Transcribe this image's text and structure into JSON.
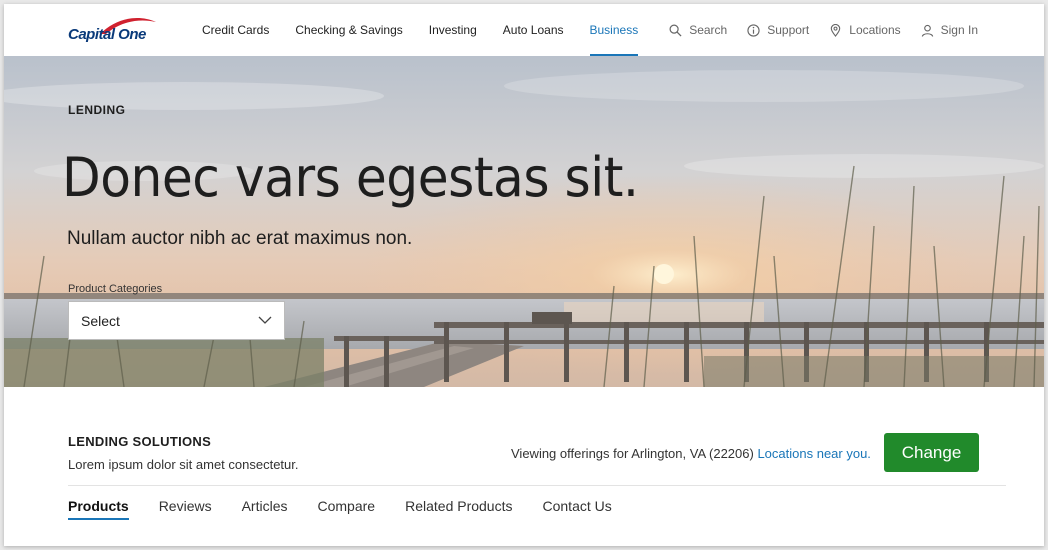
{
  "brand": {
    "logo_text": "Capital One",
    "colors": {
      "navy": "#0a3a7a",
      "swoosh": "#d0212f",
      "link": "#1a76b8",
      "cta": "#218a2b"
    }
  },
  "nav": {
    "links": [
      {
        "label": "Credit Cards",
        "active": false
      },
      {
        "label": "Checking & Savings",
        "active": false
      },
      {
        "label": "Investing",
        "active": false
      },
      {
        "label": "Auto Loans",
        "active": false
      },
      {
        "label": "Business",
        "active": true
      }
    ],
    "utilities": [
      {
        "label": "Search",
        "icon": "search-icon"
      },
      {
        "label": "Support",
        "icon": "info-circle-icon"
      },
      {
        "label": "Locations",
        "icon": "map-pin-icon"
      },
      {
        "label": "Sign In",
        "icon": "user-icon"
      }
    ]
  },
  "hero": {
    "eyebrow": "LENDING",
    "title": "Donec vars egestas sit.",
    "subtitle": "Nullam auctor nibh ac erat maximus non.",
    "select": {
      "label": "Product Categories",
      "value": "Select",
      "icon": "chevron-down-icon"
    }
  },
  "solutions": {
    "title": "LENDING SOLUTIONS",
    "description": "Lorem ipsum dolor sit amet consectetur.",
    "viewing_text": "Viewing offerings for Arlington, VA (22206)",
    "viewing_link": "Locations near you.",
    "change_button": "Change",
    "tabs": [
      {
        "label": "Products",
        "active": true
      },
      {
        "label": "Reviews",
        "active": false
      },
      {
        "label": "Articles",
        "active": false
      },
      {
        "label": "Compare",
        "active": false
      },
      {
        "label": "Related Products",
        "active": false
      },
      {
        "label": "Contact Us",
        "active": false
      }
    ]
  }
}
